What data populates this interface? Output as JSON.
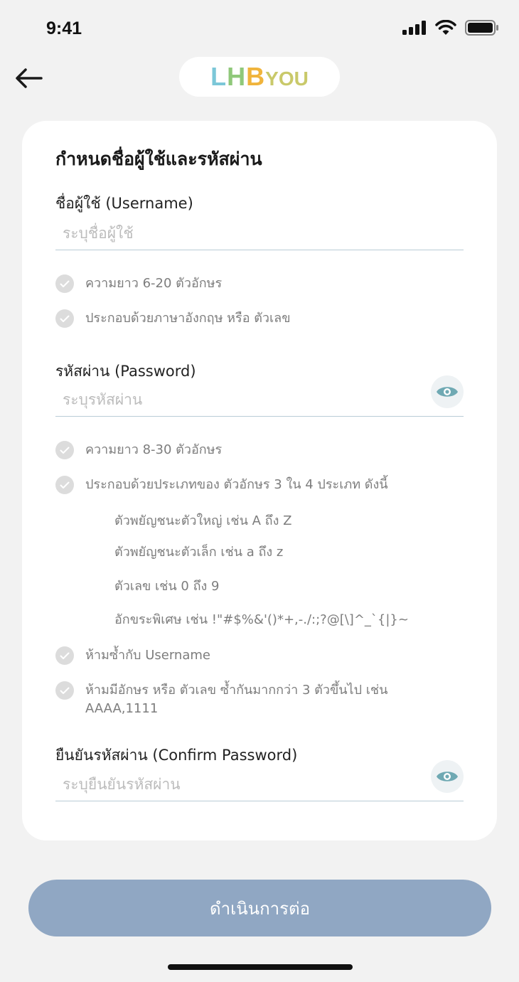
{
  "status_bar": {
    "time": "9:41"
  },
  "header": {
    "logo": {
      "l": "L",
      "h": "H",
      "b": "B",
      "you": "YOU"
    }
  },
  "card": {
    "title": "กำหนดชื่อผู้ใช้และรหัสผ่าน",
    "username": {
      "label": "ชื่อผู้ใช้ (Username)",
      "placeholder": "ระบุชื่อผู้ใช้",
      "value": "",
      "rules": [
        "ความยาว 6-20 ตัวอักษร",
        "ประกอบด้วยภาษาอังกฤษ หรือ ตัวเลข"
      ]
    },
    "password": {
      "label": "รหัสผ่าน (Password)",
      "placeholder": "ระบุรหัสผ่าน",
      "value": "",
      "rules": [
        "ความยาว 8-30 ตัวอักษร",
        "ประกอบด้วยประเภทของ ตัวอักษร 3 ใน 4 ประเภท ดังนี้"
      ],
      "sub_rules": [
        "ตัวพยัญชนะตัวใหญ่ เช่น A ถึง Z",
        "ตัวพยัญชนะตัวเล็ก เช่น a ถึง z",
        "ตัวเลข เช่น 0 ถึง 9",
        "อักขระพิเศษ เช่น !\"#$%&'()*+,-./:;?@[\\]^_`{|}~"
      ],
      "rules_after": [
        "ห้ามซ้ำกับ Username",
        "ห้ามมีอักษร หรือ ตัวเลข ซ้ำกันมากกว่า 3 ตัวขึ้นไป เช่น",
        "AAAA,1111"
      ]
    },
    "confirm_password": {
      "label": "ยืนยันรหัสผ่าน (Confirm Password)",
      "placeholder": "ระบุยืนยันรหัสผ่าน",
      "value": ""
    }
  },
  "actions": {
    "continue_label": "ดำเนินการต่อ"
  },
  "colors": {
    "background": "#f2f2f2",
    "card": "#ffffff",
    "button": "#90a7c3",
    "check_inactive": "#dcdcdc",
    "eye_icon": "#6fa9b3",
    "underline": "#b9ccd6"
  },
  "icons": {
    "back": "arrow-left-icon",
    "visibility": "eye-icon",
    "check": "check-circle-icon",
    "signal": "signal-icon",
    "wifi": "wifi-icon",
    "battery": "battery-icon"
  }
}
